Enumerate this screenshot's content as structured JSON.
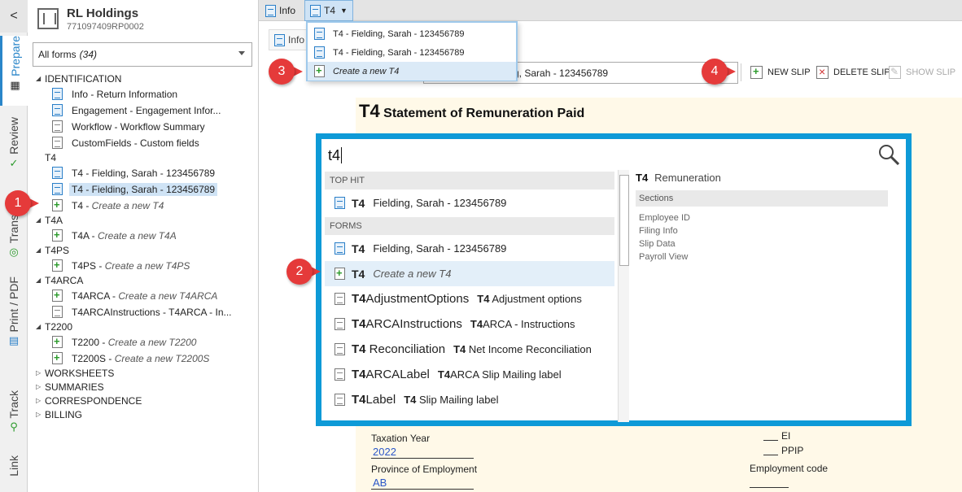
{
  "vtabs": {
    "back": "<",
    "items": [
      {
        "label": "Prepare"
      },
      {
        "label": "Review"
      },
      {
        "label": "Trans"
      },
      {
        "label": "Print / PDF"
      },
      {
        "label": "Track"
      },
      {
        "label": "Link"
      }
    ]
  },
  "client": {
    "name": "RL Holdings",
    "bn": "771097409RP0002"
  },
  "filter": {
    "label": "All forms",
    "count": "(34)"
  },
  "tree": {
    "identification": "IDENTIFICATION",
    "info": "Info - Return Information",
    "engagement": "Engagement - Engagement Infor...",
    "workflow": "Workflow - Workflow Summary",
    "customfields": "CustomFields - Custom fields",
    "t4": "T4",
    "t4_1": "T4 - Fielding, Sarah - 123456789",
    "t4_2": "T4 - Fielding, Sarah - 123456789",
    "t4_new_code": "T4 - ",
    "t4_new": "Create a new T4",
    "t4a": "T4A",
    "t4a_new_code": "T4A - ",
    "t4a_new": "Create a new T4A",
    "t4ps": "T4PS",
    "t4ps_new_code": "T4PS - ",
    "t4ps_new": "Create a new T4PS",
    "t4arca": "T4ARCA",
    "t4arca_new_code": "T4ARCA - ",
    "t4arca_new": "Create a new T4ARCA",
    "t4arcainstr": "T4ARCAInstructions - T4ARCA - In...",
    "t2200": "T2200",
    "t2200_new_code": "T2200 - ",
    "t2200_new": "Create a new T2200",
    "t2200s_new_code": "T2200S - ",
    "t2200s_new": "Create a new T2200S",
    "worksheets": "WORKSHEETS",
    "summaries": "SUMMARIES",
    "correspondence": "CORRESPONDENCE",
    "billing": "BILLING"
  },
  "tabs": {
    "info": "Info",
    "t4": "T4"
  },
  "subtab": {
    "info": "Info"
  },
  "tabdd": {
    "row1": "T4 - Fielding, Sarah - 123456789",
    "row2": "T4 - Fielding, Sarah - 123456789",
    "row3": "Create a new T4"
  },
  "toolbar": {
    "slip_value": "g, Sarah - 123456789",
    "new_slip": "NEW SLIP",
    "delete_slip": "DELETE SLIP",
    "show_slip": "SHOW SLIP"
  },
  "form": {
    "title_code": "T4",
    "title": "Statement of Remuneration Paid",
    "taxation_year_label": "Taxation Year",
    "taxation_year": "2022",
    "province_label": "Province of Employment",
    "province": "AB",
    "ei": "EI",
    "ppip": "PPIP",
    "employment_code": "Employment code"
  },
  "search": {
    "query": "t4",
    "top_hit": "TOP HIT",
    "forms": "FORMS",
    "r1_code": "T4",
    "r1_desc": "Fielding, Sarah - 123456789",
    "r2_code": "T4",
    "r2_desc": "Fielding, Sarah - 123456789",
    "r3_code": "T4",
    "r3_desc": "Create a new T4",
    "r4_code_b": "T4",
    "r4_code": "AdjustmentOptions",
    "r4_desc_b": "T4",
    "r4_desc": " Adjustment options",
    "r5_code_b": "T4",
    "r5_code": "ARCAInstructions",
    "r5_desc_b": "T4",
    "r5_desc": "ARCA - Instructions",
    "r6_code_b": "T4",
    "r6_code": " Reconciliation",
    "r6_desc_b": "T4",
    "r6_desc": " Net Income Reconciliation",
    "r7_code_b": "T4",
    "r7_code": "ARCALabel",
    "r7_desc_b": "T4",
    "r7_desc": "ARCA Slip Mailing label",
    "r8_code_b": "T4",
    "r8_code": "Label",
    "r8_desc_b": "T4",
    "r8_desc": " Slip Mailing label",
    "detail_code": "T4",
    "detail_title": "Remuneration",
    "detail_sections": "Sections",
    "detail_items": [
      "Employee ID",
      "Filing Info",
      "Slip Data",
      "Payroll View"
    ]
  },
  "callouts": [
    "1",
    "2",
    "3",
    "4"
  ],
  "colors": {
    "accent": "#0e9ad7",
    "callout": "#e53a3a",
    "selection": "#cfe3f5",
    "form_bg": "#fff9e8"
  }
}
